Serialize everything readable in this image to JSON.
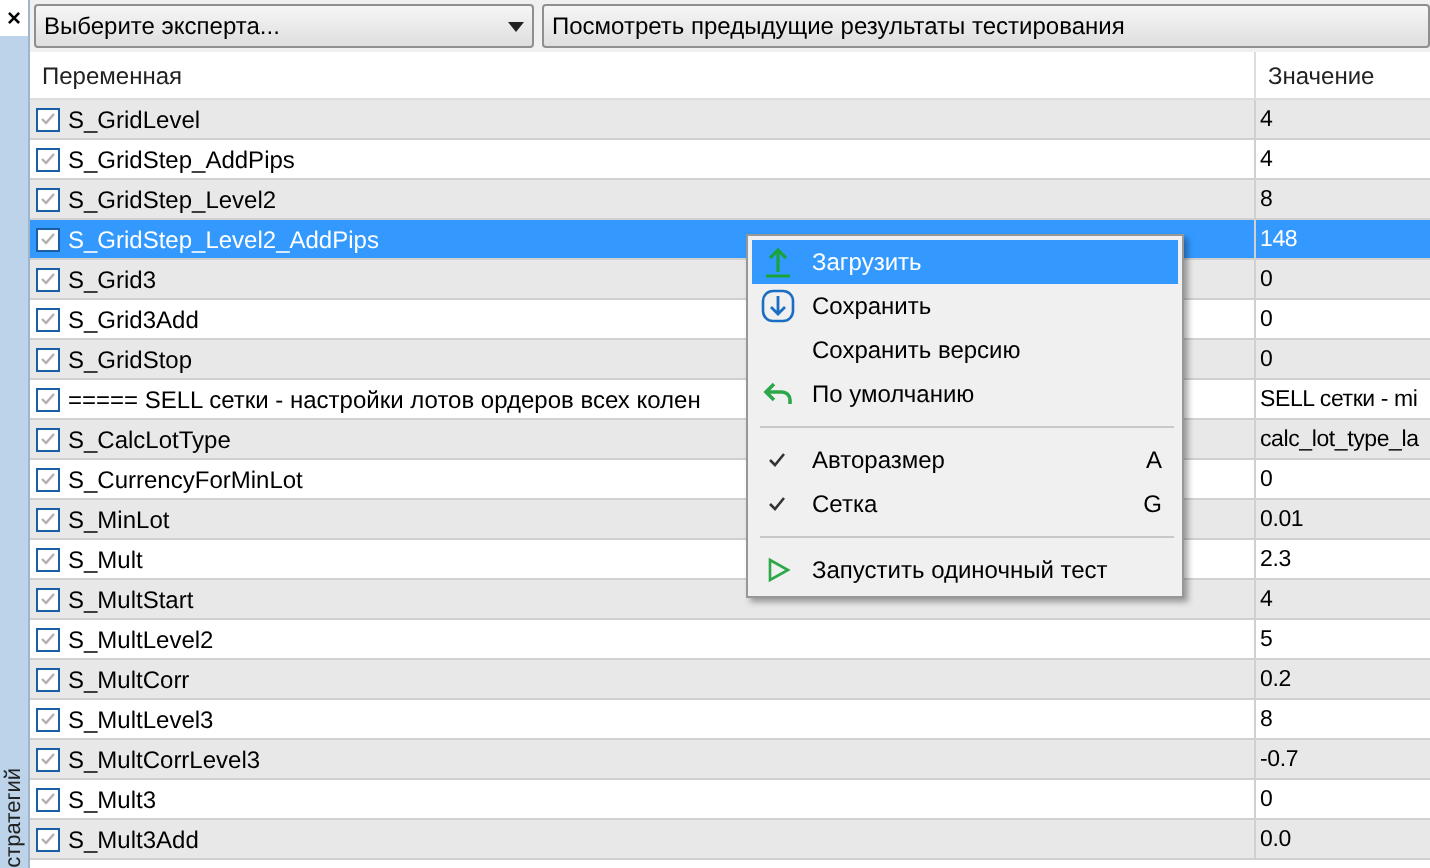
{
  "side_panel": {
    "close": "×",
    "label": "стратегий"
  },
  "toolbar": {
    "expert_select": {
      "value": "Выберите эксперта..."
    },
    "results_button": {
      "label": "Посмотреть предыдущие результаты тестирования"
    }
  },
  "table": {
    "columns": [
      "Переменная",
      "Значение"
    ],
    "rows": [
      {
        "name": "S_GridLevel",
        "value": "4",
        "checked": true,
        "selected": false
      },
      {
        "name": "S_GridStep_AddPips",
        "value": "4",
        "checked": true,
        "selected": false
      },
      {
        "name": "S_GridStep_Level2",
        "value": "8",
        "checked": true,
        "selected": false
      },
      {
        "name": "S_GridStep_Level2_AddPips",
        "value": "148",
        "checked": true,
        "selected": true
      },
      {
        "name": "S_Grid3",
        "value": "0",
        "checked": true,
        "selected": false
      },
      {
        "name": "S_Grid3Add",
        "value": "0",
        "checked": true,
        "selected": false
      },
      {
        "name": "S_GridStop",
        "value": "0",
        "checked": true,
        "selected": false
      },
      {
        "name": "===== SELL сетки - настройки лотов ордеров всех колен",
        "value": "SELL сетки - mi",
        "checked": true,
        "selected": false
      },
      {
        "name": "S_CalcLotType",
        "value": "calc_lot_type_la",
        "checked": true,
        "selected": false
      },
      {
        "name": "S_CurrencyForMinLot",
        "value": "0",
        "checked": true,
        "selected": false
      },
      {
        "name": "S_MinLot",
        "value": "0.01",
        "checked": true,
        "selected": false
      },
      {
        "name": "S_Mult",
        "value": "2.3",
        "checked": true,
        "selected": false
      },
      {
        "name": "S_MultStart",
        "value": "4",
        "checked": true,
        "selected": false
      },
      {
        "name": "S_MultLevel2",
        "value": "5",
        "checked": true,
        "selected": false
      },
      {
        "name": "S_MultCorr",
        "value": "0.2",
        "checked": true,
        "selected": false
      },
      {
        "name": "S_MultLevel3",
        "value": "8",
        "checked": true,
        "selected": false
      },
      {
        "name": "S_MultCorrLevel3",
        "value": "-0.7",
        "checked": true,
        "selected": false
      },
      {
        "name": "S_Mult3",
        "value": "0",
        "checked": true,
        "selected": false
      },
      {
        "name": "S_Mult3Add",
        "value": "0.0",
        "checked": true,
        "selected": false
      }
    ]
  },
  "context_menu": {
    "items": [
      {
        "kind": "upload",
        "label": "Загрузить",
        "selected": true
      },
      {
        "kind": "save",
        "label": "Сохранить",
        "selected": false
      },
      {
        "kind": "plain",
        "label": "Сохранить версию",
        "selected": false
      },
      {
        "kind": "reset",
        "label": "По умолчанию",
        "selected": false
      },
      {
        "kind": "separator"
      },
      {
        "kind": "toggle",
        "label": "Авторазмер",
        "shortcut": "A",
        "checked": true,
        "selected": false
      },
      {
        "kind": "toggle",
        "label": "Сетка",
        "shortcut": "G",
        "checked": true,
        "selected": false
      },
      {
        "kind": "separator"
      },
      {
        "kind": "run",
        "label": "Запустить одиночный тест",
        "selected": false
      }
    ]
  }
}
